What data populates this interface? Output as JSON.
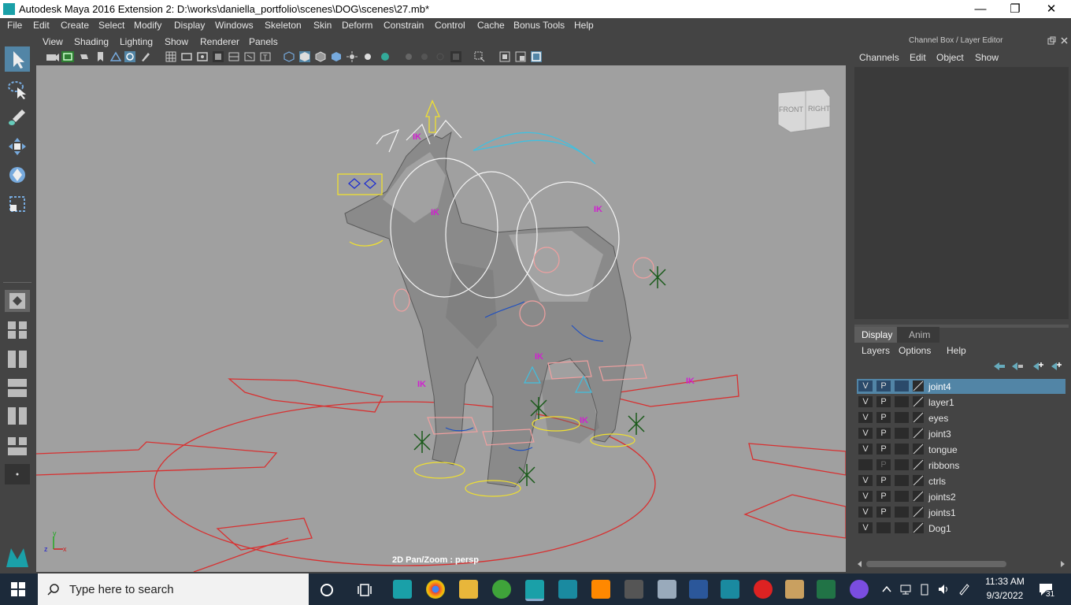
{
  "window": {
    "title": "Autodesk Maya 2016 Extension 2: D:\\works\\daniella_portfolio\\scenes\\DOG\\scenes\\27.mb*",
    "minimize_glyph": "—",
    "maximize_glyph": "❐",
    "close_glyph": "✕"
  },
  "menubar": {
    "items": [
      "File",
      "Edit",
      "Create",
      "Select",
      "Modify",
      "Display",
      "Windows",
      "Skeleton",
      "Skin",
      "Deform",
      "Constrain",
      "Control",
      "Cache",
      "Bonus Tools",
      "Help"
    ]
  },
  "panel_menu": {
    "items": [
      "View",
      "Shading",
      "Lighting",
      "Show",
      "Renderer",
      "Panels"
    ]
  },
  "viewport": {
    "status_text": "2D Pan/Zoom : persp",
    "view_cube": {
      "front_label": "FRONT",
      "right_label": "RIGHT"
    },
    "axis": {
      "x": "x",
      "y": "y",
      "z": "z"
    },
    "background_color": "#a0a0a0"
  },
  "channel_box": {
    "title": "Channel Box / Layer Editor",
    "menu": [
      "Channels",
      "Edit",
      "Object",
      "Show"
    ]
  },
  "layer_editor": {
    "tabs": [
      "Display",
      "Anim"
    ],
    "menu": [
      "Layers",
      "Options",
      "Help"
    ],
    "layers": [
      {
        "v": "V",
        "p": "P",
        "name": "joint4",
        "selected": true
      },
      {
        "v": "V",
        "p": "P",
        "name": "layer1",
        "selected": false
      },
      {
        "v": "V",
        "p": "P",
        "name": "eyes",
        "selected": false
      },
      {
        "v": "V",
        "p": "P",
        "name": "joint3",
        "selected": false
      },
      {
        "v": "V",
        "p": "P",
        "name": "tongue",
        "selected": false
      },
      {
        "v": "",
        "p": "P",
        "name": "ribbons",
        "selected": false
      },
      {
        "v": "V",
        "p": "P",
        "name": "ctrls",
        "selected": false
      },
      {
        "v": "V",
        "p": "P",
        "name": "joints2",
        "selected": false
      },
      {
        "v": "V",
        "p": "P",
        "name": "joints1",
        "selected": false
      },
      {
        "v": "V",
        "p": "",
        "name": "Dog1",
        "selected": false
      }
    ]
  },
  "taskbar": {
    "search_placeholder": "Type here to search",
    "time": "11:33 AM",
    "date": "9/3/2022",
    "notification_count": "31"
  },
  "colors": {
    "accent_blue": "#5285a6",
    "maya_teal": "#1aa0a8",
    "rig_red": "#d83030",
    "rig_yellow": "#f0e030",
    "rig_cyan": "#40c0e0",
    "rig_magenta": "#d020d0"
  }
}
